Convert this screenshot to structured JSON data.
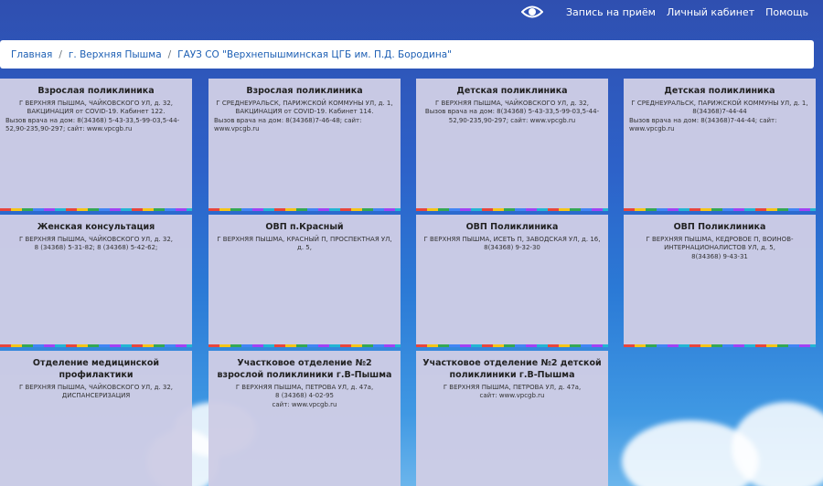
{
  "topnav": {
    "appointment": "Запись на приём",
    "cabinet": "Личный кабинет",
    "help": "Помощь"
  },
  "breadcrumb": {
    "home": "Главная",
    "city": "г. Верхняя Пышма",
    "org": "ГАУЗ СО \"Верхнепышминская ЦГБ им. П.Д. Бородина\""
  },
  "cards": [
    {
      "title": "Взрослая поликлиника",
      "address": "Г ВЕРХНЯЯ ПЫШМА, ЧАЙКОВСКОГО УЛ, д. 32,",
      "extra": "ВАКЦИНАЦИЯ от COVID-19. Кабинет 122.",
      "extra2": "Вызов врача на дом: 8(34368) 5-43-33,5-99-03,5-44-52,90-235,90-297; сайт: www.vpcgb.ru"
    },
    {
      "title": "Взрослая поликлиника",
      "address": "Г СРЕДНЕУРАЛЬСК, ПАРИЖСКОЙ КОММУНЫ УЛ, д. 1,",
      "extra": "ВАКЦИНАЦИЯ от COVID-19. Кабинет 114.",
      "extra2": "Вызов врача на дом: 8(34368)7-46-48; сайт: www.vpcgb.ru"
    },
    {
      "title": "Детская поликлиника",
      "address": "Г ВЕРХНЯЯ ПЫШМА, ЧАЙКОВСКОГО УЛ, д. 32,",
      "extra": "Вызов врача на дом: 8(34368) 5-43-33,5-99-03,5-44-52,90-235,90-297; сайт: www.vpcgb.ru",
      "extra2": ""
    },
    {
      "title": "Детская поликлиника",
      "address": "Г СРЕДНЕУРАЛЬСК, ПАРИЖСКОЙ КОММУНЫ УЛ, д. 1,",
      "extra": "8(34368)7-44-44",
      "extra2": "Вызов врача на дом: 8(34368)7-44-44; сайт: www.vpcgb.ru"
    },
    {
      "title": "Женская консультация",
      "address": "Г ВЕРХНЯЯ ПЫШМА, ЧАЙКОВСКОГО УЛ, д. 32,",
      "extra": "8 (34368) 5-31-82; 8 (34368) 5-42-62;",
      "extra2": ""
    },
    {
      "title": "ОВП п.Красный",
      "address": "Г ВЕРХНЯЯ ПЫШМА, КРАСНЫЙ П, ПРОСПЕКТНАЯ УЛ, д. 5,",
      "extra": "",
      "extra2": ""
    },
    {
      "title": "ОВП Поликлиника",
      "address": "Г ВЕРХНЯЯ ПЫШМА, ИСЕТЬ П, ЗАВОДСКАЯ УЛ, д. 16,",
      "extra": "8(34368) 9-32-30",
      "extra2": ""
    },
    {
      "title": "ОВП Поликлиника",
      "address": "Г ВЕРХНЯЯ ПЫШМА, КЕДРОВОЕ П, ВОИНОВ-ИНТЕРНАЦИОНАЛИСТОВ УЛ, д. 5,",
      "extra": "8(34368) 9-43-31",
      "extra2": ""
    },
    {
      "title": "Отделение медицинской профилактики",
      "address": "Г ВЕРХНЯЯ ПЫШМА, ЧАЙКОВСКОГО УЛ, д. 32,",
      "extra": "ДИСПАНСЕРИЗАЦИЯ",
      "extra2": ""
    },
    {
      "title": "Участковое отделение №2 взрослой поликлиники г.В-Пышма",
      "address": "Г ВЕРХНЯЯ ПЫШМА, ПЕТРОВА УЛ, д. 47а,",
      "extra": "8 (34368) 4-02-95",
      "extra2": "сайт: www.vpcgb.ru"
    },
    {
      "title": "Участковое отделение №2 детской поликлиники г.В-Пышма",
      "address": "Г ВЕРХНЯЯ ПЫШМА, ПЕТРОВА УЛ, д. 47а,",
      "extra": "сайт: www.vpcgb.ru",
      "extra2": ""
    }
  ]
}
